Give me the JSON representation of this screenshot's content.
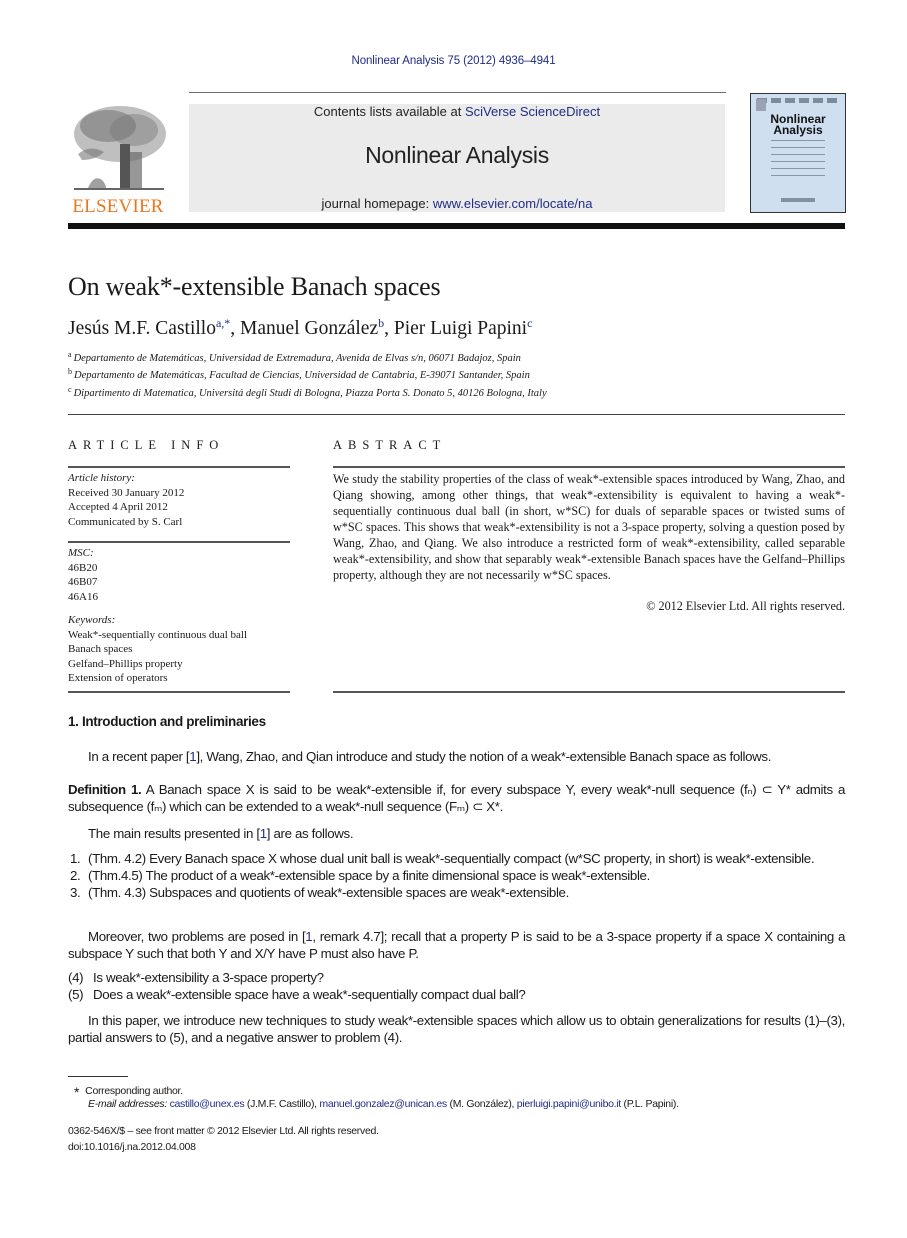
{
  "citation": "Nonlinear Analysis 75 (2012) 4936–4941",
  "header": {
    "publisher_logo_text": "ELSEVIER",
    "contents_prefix": "Contents lists available at ",
    "contents_link": "SciVerse ScienceDirect",
    "journal_name": "Nonlinear Analysis",
    "homepage_prefix": "journal homepage: ",
    "homepage_link": "www.elsevier.com/locate/na",
    "cover_title_line1": "Nonlinear",
    "cover_title_line2": "Analysis",
    "colors": {
      "link": "#1f2d86",
      "logo": "#e8771f",
      "band": "#ebebeb",
      "cover": "#cfdff0"
    }
  },
  "article": {
    "title": "On weak*-extensible Banach spaces",
    "authors": [
      {
        "name": "Jesús M.F. Castillo",
        "sup": "a,*"
      },
      {
        "name": "Manuel González",
        "sup": "b"
      },
      {
        "name": "Pier Luigi Papini",
        "sup": "c"
      }
    ],
    "affiliations": [
      {
        "sup": "a",
        "text": "Departamento de Matemáticas, Universidad de Extremadura, Avenida de Elvas s/n, 06071 Badajoz, Spain"
      },
      {
        "sup": "b",
        "text": "Departamento de Matemáticas, Facultad de Ciencias, Universidad de Cantabria, E-39071 Santander, Spain"
      },
      {
        "sup": "c",
        "text": "Dipartimento di Matematica, Universitá degli Studi di Bologna, Piazza Porta S. Donato 5, 40126 Bologna, Italy"
      }
    ]
  },
  "article_info": {
    "heading": "ARTICLE INFO",
    "history_label": "Article history:",
    "history": [
      "Received 30 January 2012",
      "Accepted 4 April 2012",
      "Communicated by S. Carl"
    ],
    "msc_label": "MSC:",
    "msc": [
      "46B20",
      "46B07",
      "46A16"
    ],
    "keywords_label": "Keywords:",
    "keywords": [
      "Weak*-sequentially continuous dual ball",
      "Banach spaces",
      "Gelfand–Phillips property",
      "Extension of operators"
    ]
  },
  "abstract": {
    "heading": "ABSTRACT",
    "text": "We study the stability properties of the class of weak*-extensible spaces introduced by Wang, Zhao, and Qiang showing, among other things, that weak*-extensibility is equivalent to having a weak*-sequentially continuous dual ball (in short, w*SC) for duals of separable spaces or twisted sums of w*SC spaces. This shows that weak*-extensibility is not a 3-space property, solving a question posed by Wang, Zhao, and Qiang. We also introduce a restricted form of weak*-extensibility, called separable weak*-extensibility, and show that separably weak*-extensible Banach spaces have the Gelfand–Phillips property, although they are not necessarily w*SC spaces.",
    "copyright": "© 2012 Elsevier Ltd. All rights reserved."
  },
  "body": {
    "section_heading": "1.  Introduction and preliminaries",
    "intro": {
      "before": "In a recent paper [",
      "ref": "1",
      "after": "], Wang, Zhao, and Qian introduce and study the notion of a weak*-extensible Banach space as follows."
    },
    "definition": {
      "label": "Definition 1.",
      "text": " A Banach space X is said to be weak*-extensible if, for every subspace Y, every weak*-null sequence (fₙ) ⊂ Y* admits a subsequence (fₘ) which can be extended to a weak*-null sequence (Fₘ) ⊂ X*."
    },
    "main_results_intro": {
      "before": "The main results presented in [",
      "ref": "1",
      "after": "] are as follows."
    },
    "results": [
      {
        "num": "1.",
        "text": "(Thm. 4.2) Every Banach space X whose dual unit ball is weak*-sequentially compact (w*SC property, in short) is weak*-extensible."
      },
      {
        "num": "2.",
        "text": "(Thm.4.5) The product of a weak*-extensible space by a finite dimensional space is weak*-extensible."
      },
      {
        "num": "3.",
        "text": "(Thm. 4.3) Subspaces and quotients of weak*-extensible spaces are weak*-extensible."
      }
    ],
    "moreover": {
      "before": "Moreover, two problems are posed in [",
      "ref": "1",
      "after": ", remark 4.7]; recall that a property P is said to be a 3-space property if a space X containing a subspace Y such that both Y and X/Y have P must also have P."
    },
    "problems": [
      {
        "num": "(4)",
        "text": "Is weak*-extensibility a 3-space property?"
      },
      {
        "num": "(5)",
        "text": "Does a weak*-extensible space have a weak*-sequentially compact dual ball?"
      }
    ],
    "paper_para": "In this paper, we introduce new techniques to study weak*-extensible spaces which allow us to obtain generalizations for results (1)–(3), partial answers to (5), and a negative answer to problem (4)."
  },
  "footnotes": {
    "corresponding_star": "*",
    "corresponding": "Corresponding author.",
    "email_label": "E-mail addresses:",
    "emails": [
      {
        "address": "castillo@unex.es",
        "owner": " (J.M.F. Castillo), "
      },
      {
        "address": "manuel.gonzalez@unican.es",
        "owner": " (M. González), "
      },
      {
        "address": "pierluigi.papini@unibo.it",
        "owner": " (P.L. Papini)."
      }
    ],
    "front_matter": "0362-546X/$ – see front matter © 2012 Elsevier Ltd. All rights reserved.",
    "doi": "doi:10.1016/j.na.2012.04.008"
  }
}
